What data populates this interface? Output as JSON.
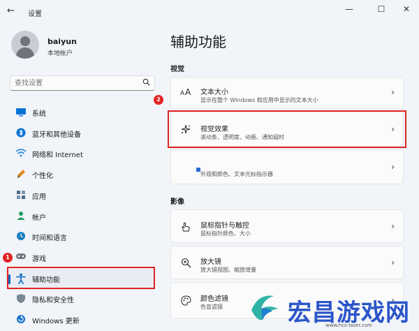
{
  "window": {
    "title": "设置",
    "back_symbol": "←",
    "minimize_symbol": "—",
    "maximize_symbol": "☐",
    "close_symbol": "✕"
  },
  "profile": {
    "name": "baiyun",
    "account_type": "本地帐户"
  },
  "search": {
    "placeholder": "查找设置"
  },
  "nav": {
    "items": [
      {
        "label": "系统",
        "icon": "monitor-icon",
        "color": "#0a74d6"
      },
      {
        "label": "蓝牙和其他设备",
        "icon": "bluetooth-icon",
        "color": "#0a74d6"
      },
      {
        "label": "网络和 Internet",
        "icon": "wifi-icon",
        "color": "#2c8bd8"
      },
      {
        "label": "个性化",
        "icon": "brush-icon",
        "color": "#e08a1e"
      },
      {
        "label": "应用",
        "icon": "apps-icon",
        "color": "#4f6b88"
      },
      {
        "label": "帐户",
        "icon": "person-icon",
        "color": "#1e9c62"
      },
      {
        "label": "时间和语言",
        "icon": "globe-clock-icon",
        "color": "#1a7fc1"
      },
      {
        "label": "游戏",
        "icon": "gamepad-icon",
        "color": "#6f7780"
      },
      {
        "label": "辅助功能",
        "icon": "accessibility-icon",
        "color": "#1a73c8"
      },
      {
        "label": "隐私和安全性",
        "icon": "shield-icon",
        "color": "#7b8794"
      },
      {
        "label": "Windows 更新",
        "icon": "update-icon",
        "color": "#1a73c8"
      }
    ],
    "selected_index": 8
  },
  "badges": {
    "first": "1",
    "second": "2"
  },
  "main": {
    "title": "辅助功能",
    "sections": [
      {
        "heading": "视觉",
        "cards": [
          {
            "title": "文本大小",
            "subtitle": "显示在整个 Windows 和应用中显示的文本大小",
            "icon": "text-size-icon"
          },
          {
            "title": "视觉效果",
            "subtitle": "滚动条、透明度、动画、通知超时",
            "icon": "sparkle-icon"
          },
          {
            "title": "",
            "subtitle": "外观和颜色、文本光标指示器",
            "icon": "cursor-icon"
          }
        ]
      },
      {
        "heading": "影像",
        "cards": [
          {
            "title": "鼠标指针与触控",
            "subtitle": "鼠标指针颜色、大小",
            "icon": "pointer-hand-icon"
          },
          {
            "title": "放大镜",
            "subtitle": "放大镜视图、缩放增量",
            "icon": "magnifier-icon"
          },
          {
            "title": "颜色滤镜",
            "subtitle": "色盲滤镜",
            "icon": "palette-icon"
          }
        ]
      }
    ],
    "chevron": "›"
  },
  "watermark": {
    "text": "宏昌游戏网",
    "url": "www.hcs-laser.com"
  },
  "colors": {
    "accent": "#0067c0",
    "highlight_red": "#e02424"
  }
}
